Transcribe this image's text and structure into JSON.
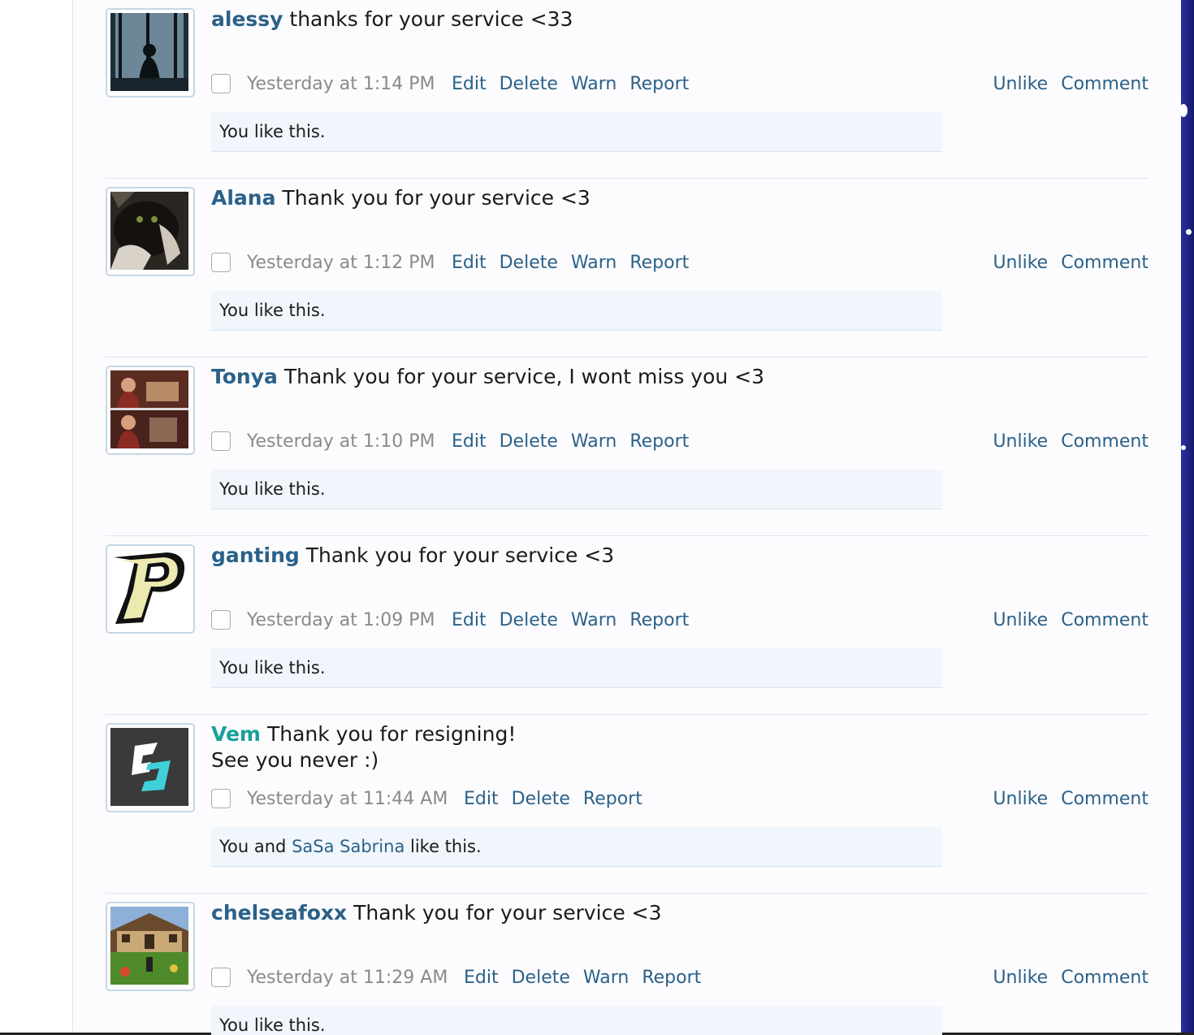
{
  "posts": [
    {
      "username": "alessy",
      "message": "thanks for your service <33",
      "timestamp": "Yesterday at 1:14 PM",
      "actions": [
        "Edit",
        "Delete",
        "Warn",
        "Report"
      ],
      "right_actions": [
        "Unlike",
        "Comment"
      ],
      "likes": {
        "prefix": "You like this.",
        "name": "",
        "suffix": ""
      }
    },
    {
      "username": "Alana",
      "message": "Thank you for your service <3",
      "timestamp": "Yesterday at 1:12 PM",
      "actions": [
        "Edit",
        "Delete",
        "Warn",
        "Report"
      ],
      "right_actions": [
        "Unlike",
        "Comment"
      ],
      "likes": {
        "prefix": "You like this.",
        "name": "",
        "suffix": ""
      }
    },
    {
      "username": "Tonya",
      "message": "Thank you for your service, I wont miss you <3",
      "timestamp": "Yesterday at 1:10 PM",
      "actions": [
        "Edit",
        "Delete",
        "Warn",
        "Report"
      ],
      "right_actions": [
        "Unlike",
        "Comment"
      ],
      "likes": {
        "prefix": "You like this.",
        "name": "",
        "suffix": ""
      }
    },
    {
      "username": "ganting",
      "message": "Thank you for your service <3",
      "timestamp": "Yesterday at 1:09 PM",
      "actions": [
        "Edit",
        "Delete",
        "Warn",
        "Report"
      ],
      "right_actions": [
        "Unlike",
        "Comment"
      ],
      "likes": {
        "prefix": "You like this.",
        "name": "",
        "suffix": ""
      }
    },
    {
      "username": "Vem",
      "message": "Thank you for resigning!\nSee you never :)",
      "timestamp": "Yesterday at 11:44 AM",
      "actions": [
        "Edit",
        "Delete",
        "Report"
      ],
      "right_actions": [
        "Unlike",
        "Comment"
      ],
      "likes": {
        "prefix": "You and ",
        "name": "SaSa Sabrina",
        "suffix": " like this."
      }
    },
    {
      "username": "chelseafoxx",
      "message": "Thank you for your service <3",
      "timestamp": "Yesterday at 11:29 AM",
      "actions": [
        "Edit",
        "Delete",
        "Warn",
        "Report"
      ],
      "right_actions": [
        "Unlike",
        "Comment"
      ],
      "likes": {
        "prefix": "You like this.",
        "name": "",
        "suffix": ""
      }
    }
  ]
}
